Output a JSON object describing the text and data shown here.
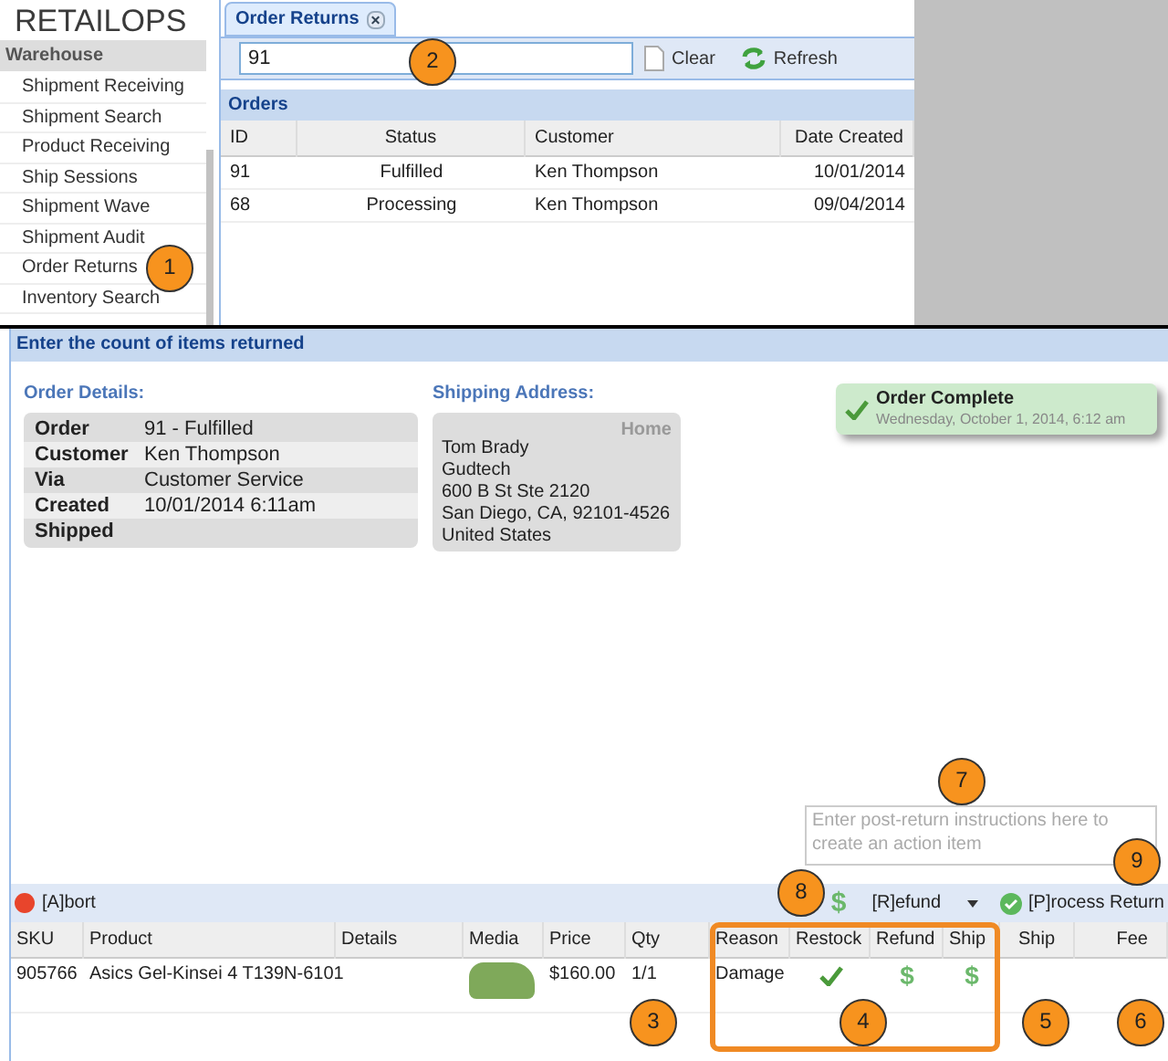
{
  "logo": "RETAILOPS",
  "sidebar": {
    "header": "Warehouse",
    "items": [
      "Shipment Receiving",
      "Shipment Search",
      "Product Receiving",
      "Ship Sessions",
      "Shipment Wave",
      "Shipment Audit",
      "Order Returns",
      "Inventory Search"
    ]
  },
  "tab": {
    "label": "Order Returns",
    "selected": true,
    "close": "×"
  },
  "search": {
    "value": "91"
  },
  "toolbar": [
    "Clear",
    "Refresh"
  ],
  "orders": {
    "title": "Orders",
    "columns": [
      "ID",
      "Status",
      "Customer",
      "Date Created"
    ],
    "rows": [
      [
        "91",
        "Fulfilled",
        "Ken Thompson",
        "10/01/2014"
      ],
      [
        "68",
        "Processing",
        "Ken Thompson",
        "09/04/2014"
      ]
    ]
  },
  "panel_title": "Enter the count of items returned",
  "order_details": {
    "title": "Order Details:",
    "fields": [
      {
        "label": "Order",
        "value": "91 - Fulfilled"
      },
      {
        "label": "Customer",
        "value": "Ken Thompson"
      },
      {
        "label": "Via",
        "value": "Customer Service"
      },
      {
        "label": "Created",
        "value": "10/01/2014 6:11am"
      },
      {
        "label": "Shipped"
      }
    ]
  },
  "shipping": {
    "title": "Shipping Address:",
    "tag": "Home",
    "lines": [
      "Tom Brady",
      "Gudtech",
      "600 B St Ste 2120",
      "San Diego, CA, 92101-4526",
      "United States"
    ]
  },
  "toast": {
    "title": "Order Complete",
    "time": "Wednesday, October 1, 2014, 6:12 am"
  },
  "instructions": {
    "placeholder": "Enter post-return instructions here to create an action item"
  },
  "actions": {
    "abort": "[A]bort",
    "refund_icon": "$",
    "refund": "[R]efund",
    "process": "[P]rocess Return"
  },
  "items": {
    "columns": [
      "SKU",
      "Product",
      "Details",
      "Media",
      "Price",
      "Qty",
      "Reason",
      "Restock",
      "Refund",
      "Ship",
      "Ship",
      "Fee"
    ],
    "rows": [
      {
        "sku": "905766",
        "product": "Asics Gel-Kinsei 4 T139N-6101",
        "price": "$160.00",
        "qty": "1/1",
        "reason": "Damage",
        "restock": true,
        "refund": "$",
        "ship_refund": "$"
      }
    ]
  },
  "callouts": [
    "1",
    "2",
    "3",
    "4",
    "5",
    "6",
    "7",
    "8",
    "9"
  ]
}
